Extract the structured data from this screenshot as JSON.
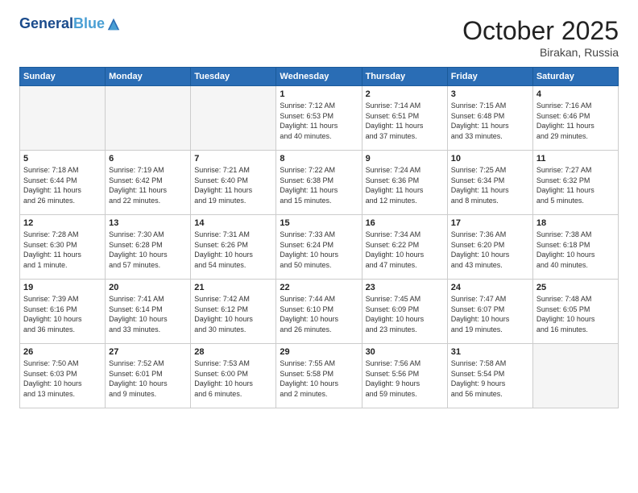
{
  "header": {
    "logo_line1": "General",
    "logo_line2": "Blue",
    "month_title": "October 2025",
    "location": "Birakan, Russia"
  },
  "weekdays": [
    "Sunday",
    "Monday",
    "Tuesday",
    "Wednesday",
    "Thursday",
    "Friday",
    "Saturday"
  ],
  "weeks": [
    [
      {
        "day": "",
        "info": ""
      },
      {
        "day": "",
        "info": ""
      },
      {
        "day": "",
        "info": ""
      },
      {
        "day": "1",
        "info": "Sunrise: 7:12 AM\nSunset: 6:53 PM\nDaylight: 11 hours\nand 40 minutes."
      },
      {
        "day": "2",
        "info": "Sunrise: 7:14 AM\nSunset: 6:51 PM\nDaylight: 11 hours\nand 37 minutes."
      },
      {
        "day": "3",
        "info": "Sunrise: 7:15 AM\nSunset: 6:48 PM\nDaylight: 11 hours\nand 33 minutes."
      },
      {
        "day": "4",
        "info": "Sunrise: 7:16 AM\nSunset: 6:46 PM\nDaylight: 11 hours\nand 29 minutes."
      }
    ],
    [
      {
        "day": "5",
        "info": "Sunrise: 7:18 AM\nSunset: 6:44 PM\nDaylight: 11 hours\nand 26 minutes."
      },
      {
        "day": "6",
        "info": "Sunrise: 7:19 AM\nSunset: 6:42 PM\nDaylight: 11 hours\nand 22 minutes."
      },
      {
        "day": "7",
        "info": "Sunrise: 7:21 AM\nSunset: 6:40 PM\nDaylight: 11 hours\nand 19 minutes."
      },
      {
        "day": "8",
        "info": "Sunrise: 7:22 AM\nSunset: 6:38 PM\nDaylight: 11 hours\nand 15 minutes."
      },
      {
        "day": "9",
        "info": "Sunrise: 7:24 AM\nSunset: 6:36 PM\nDaylight: 11 hours\nand 12 minutes."
      },
      {
        "day": "10",
        "info": "Sunrise: 7:25 AM\nSunset: 6:34 PM\nDaylight: 11 hours\nand 8 minutes."
      },
      {
        "day": "11",
        "info": "Sunrise: 7:27 AM\nSunset: 6:32 PM\nDaylight: 11 hours\nand 5 minutes."
      }
    ],
    [
      {
        "day": "12",
        "info": "Sunrise: 7:28 AM\nSunset: 6:30 PM\nDaylight: 11 hours\nand 1 minute."
      },
      {
        "day": "13",
        "info": "Sunrise: 7:30 AM\nSunset: 6:28 PM\nDaylight: 10 hours\nand 57 minutes."
      },
      {
        "day": "14",
        "info": "Sunrise: 7:31 AM\nSunset: 6:26 PM\nDaylight: 10 hours\nand 54 minutes."
      },
      {
        "day": "15",
        "info": "Sunrise: 7:33 AM\nSunset: 6:24 PM\nDaylight: 10 hours\nand 50 minutes."
      },
      {
        "day": "16",
        "info": "Sunrise: 7:34 AM\nSunset: 6:22 PM\nDaylight: 10 hours\nand 47 minutes."
      },
      {
        "day": "17",
        "info": "Sunrise: 7:36 AM\nSunset: 6:20 PM\nDaylight: 10 hours\nand 43 minutes."
      },
      {
        "day": "18",
        "info": "Sunrise: 7:38 AM\nSunset: 6:18 PM\nDaylight: 10 hours\nand 40 minutes."
      }
    ],
    [
      {
        "day": "19",
        "info": "Sunrise: 7:39 AM\nSunset: 6:16 PM\nDaylight: 10 hours\nand 36 minutes."
      },
      {
        "day": "20",
        "info": "Sunrise: 7:41 AM\nSunset: 6:14 PM\nDaylight: 10 hours\nand 33 minutes."
      },
      {
        "day": "21",
        "info": "Sunrise: 7:42 AM\nSunset: 6:12 PM\nDaylight: 10 hours\nand 30 minutes."
      },
      {
        "day": "22",
        "info": "Sunrise: 7:44 AM\nSunset: 6:10 PM\nDaylight: 10 hours\nand 26 minutes."
      },
      {
        "day": "23",
        "info": "Sunrise: 7:45 AM\nSunset: 6:09 PM\nDaylight: 10 hours\nand 23 minutes."
      },
      {
        "day": "24",
        "info": "Sunrise: 7:47 AM\nSunset: 6:07 PM\nDaylight: 10 hours\nand 19 minutes."
      },
      {
        "day": "25",
        "info": "Sunrise: 7:48 AM\nSunset: 6:05 PM\nDaylight: 10 hours\nand 16 minutes."
      }
    ],
    [
      {
        "day": "26",
        "info": "Sunrise: 7:50 AM\nSunset: 6:03 PM\nDaylight: 10 hours\nand 13 minutes."
      },
      {
        "day": "27",
        "info": "Sunrise: 7:52 AM\nSunset: 6:01 PM\nDaylight: 10 hours\nand 9 minutes."
      },
      {
        "day": "28",
        "info": "Sunrise: 7:53 AM\nSunset: 6:00 PM\nDaylight: 10 hours\nand 6 minutes."
      },
      {
        "day": "29",
        "info": "Sunrise: 7:55 AM\nSunset: 5:58 PM\nDaylight: 10 hours\nand 2 minutes."
      },
      {
        "day": "30",
        "info": "Sunrise: 7:56 AM\nSunset: 5:56 PM\nDaylight: 9 hours\nand 59 minutes."
      },
      {
        "day": "31",
        "info": "Sunrise: 7:58 AM\nSunset: 5:54 PM\nDaylight: 9 hours\nand 56 minutes."
      },
      {
        "day": "",
        "info": ""
      }
    ]
  ]
}
